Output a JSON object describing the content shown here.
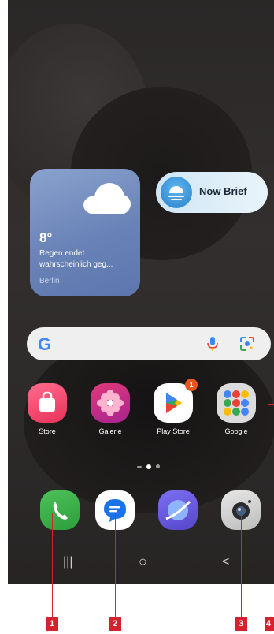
{
  "weather": {
    "temperature": "8°",
    "description": "Regen endet wahrscheinlich geg...",
    "city": "Berlin"
  },
  "now_brief": {
    "label": "Now Brief"
  },
  "search": {
    "logo": "G"
  },
  "apps": [
    {
      "label": "Store",
      "icon": "store-icon"
    },
    {
      "label": "Galerie",
      "icon": "gallery-flower-icon"
    },
    {
      "label": "Play Store",
      "icon": "play-store-icon",
      "badge": "1"
    },
    {
      "label": "Google",
      "icon": "google-folder-icon"
    }
  ],
  "dock": [
    {
      "icon": "phone-icon"
    },
    {
      "icon": "messages-icon"
    },
    {
      "icon": "internet-icon"
    },
    {
      "icon": "camera-icon"
    }
  ],
  "navigation": {
    "recents": "|||",
    "home": "○",
    "back": "<"
  },
  "callouts": [
    "1",
    "2",
    "3",
    "4"
  ],
  "colors": {
    "callout": "#d4232e",
    "weather_widget": "#6983b8",
    "now_brief": "#cfe6f5",
    "badge": "#e9541f"
  }
}
